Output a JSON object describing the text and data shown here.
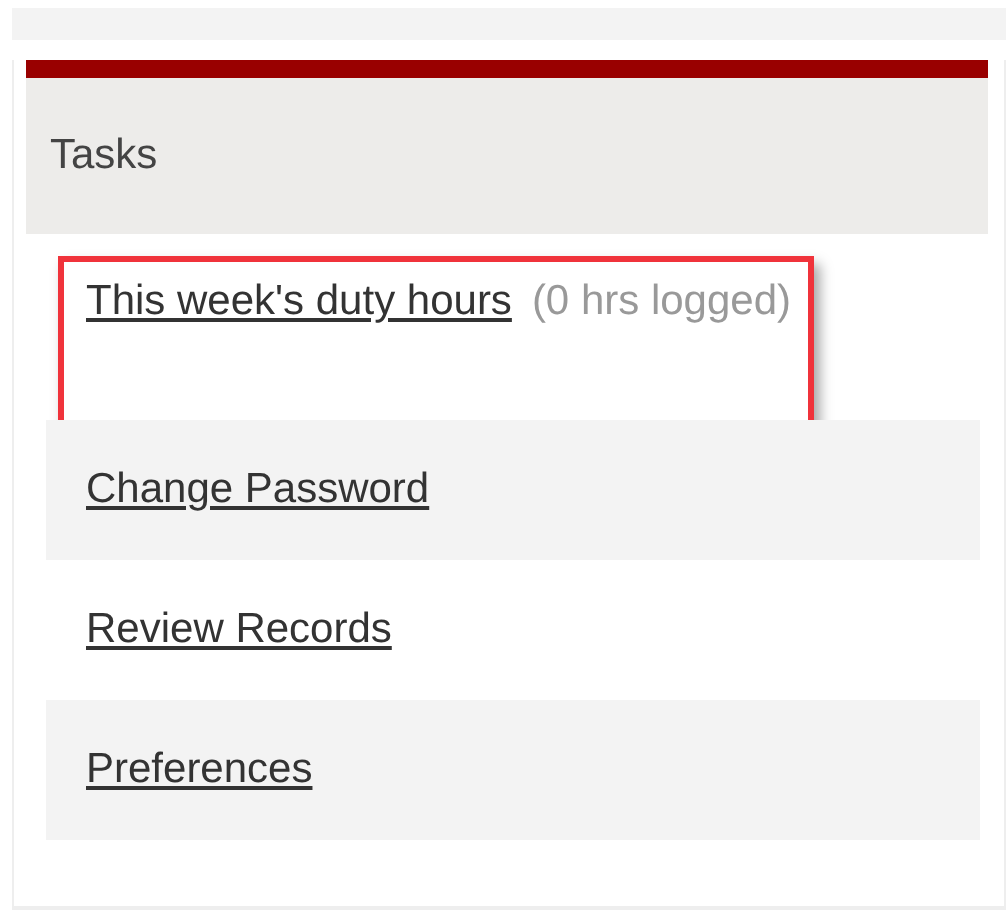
{
  "panel": {
    "title": "Tasks",
    "items": [
      {
        "label": "This week's duty hours",
        "note": "(0 hrs logged)",
        "highlighted": true
      },
      {
        "label": "Change Password",
        "highlighted": false
      },
      {
        "label": "Review Records",
        "highlighted": false
      },
      {
        "label": "Preferences",
        "highlighted": false
      }
    ]
  }
}
